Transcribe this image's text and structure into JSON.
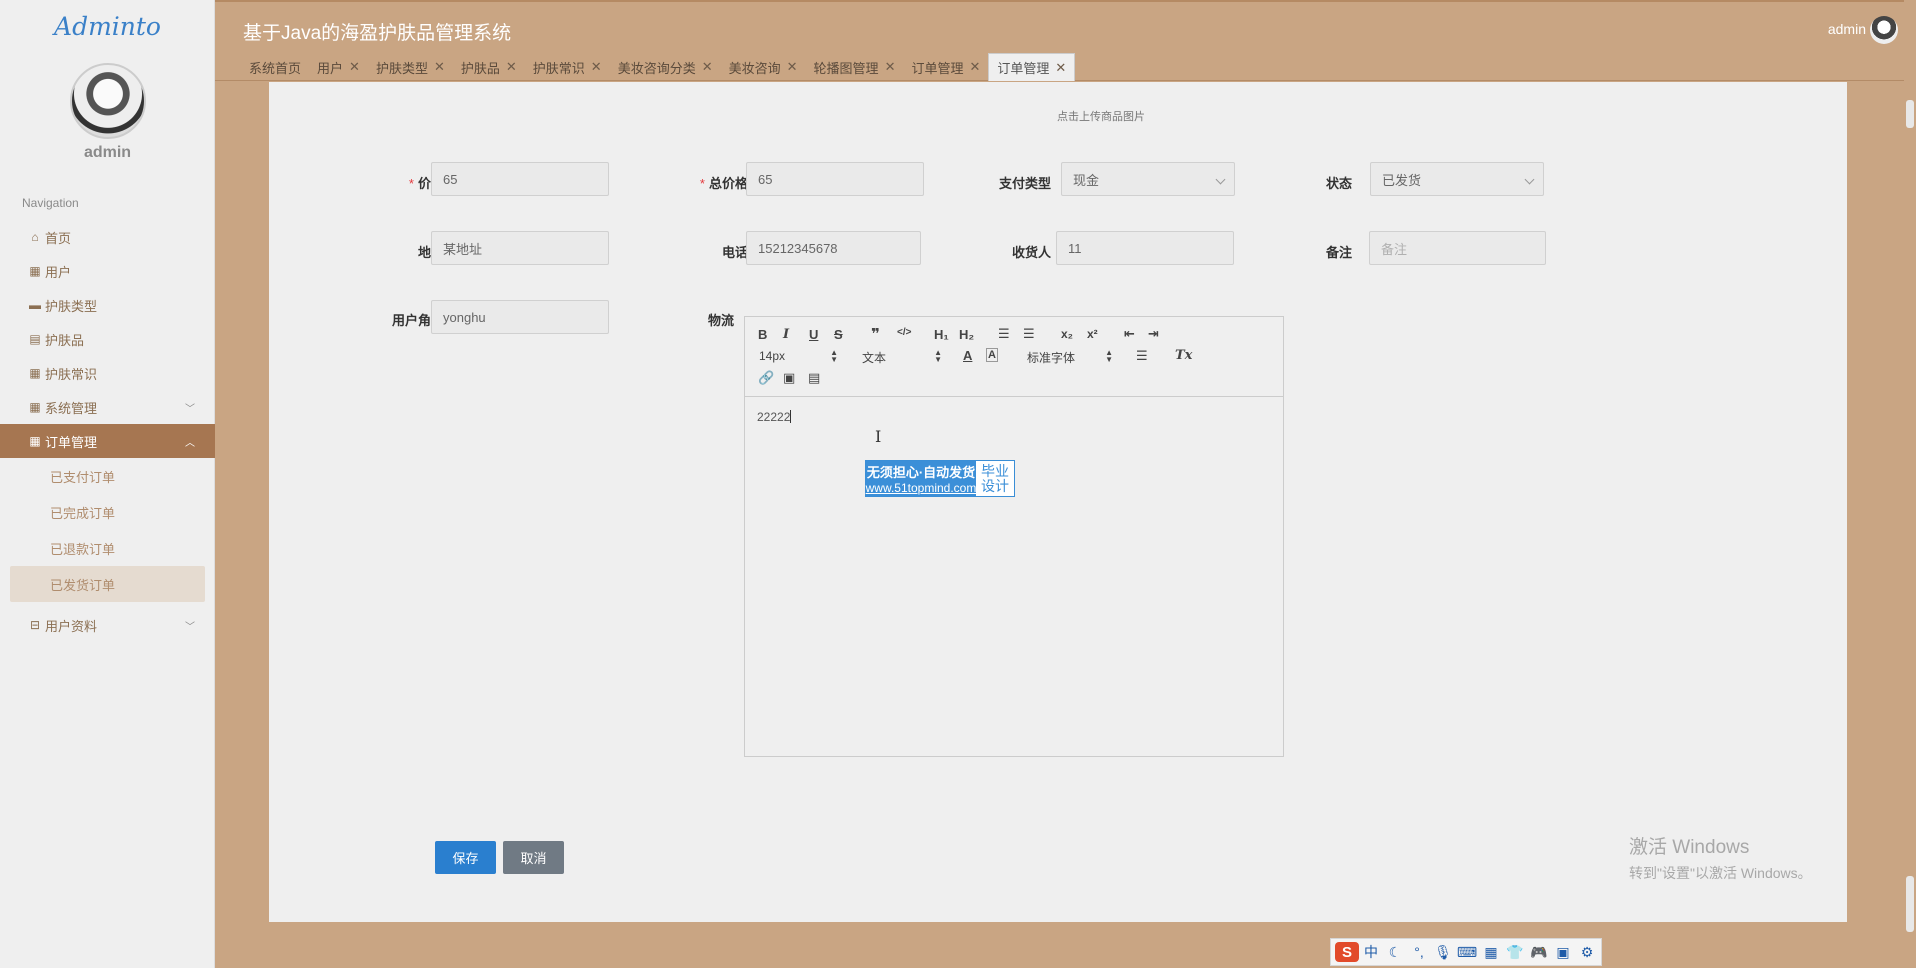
{
  "app": {
    "brand": "Adminto",
    "title": "基于Java的海盈护肤品管理系统",
    "user": "admin"
  },
  "sidebar": {
    "user_name": "admin",
    "caption": "Navigation",
    "items": [
      {
        "label": "首页",
        "icon": "home-icon"
      },
      {
        "label": "用户",
        "icon": "grid-icon"
      },
      {
        "label": "护肤类型",
        "icon": "bookmark-icon"
      },
      {
        "label": "护肤品",
        "icon": "clipboard-icon"
      },
      {
        "label": "护肤常识",
        "icon": "grid-icon"
      },
      {
        "label": "系统管理",
        "icon": "grid-icon"
      },
      {
        "label": "订单管理",
        "icon": "grid-icon"
      },
      {
        "label": "用户资料",
        "icon": "folder-icon"
      }
    ],
    "sub_items": [
      "已支付订单",
      "已完成订单",
      "已退款订单",
      "已发货订单"
    ]
  },
  "tabs": [
    "系统首页",
    "用户",
    "护肤类型",
    "护肤品",
    "护肤常识",
    "美妆咨询分类",
    "美妆咨询",
    "轮播图管理",
    "订单管理",
    "订单管理"
  ],
  "form": {
    "upload_hint": "点击上传商品图片",
    "price_label": "价格",
    "price_value": "65",
    "total_label": "总价格",
    "total_value": "65",
    "pay_type_label": "支付类型",
    "pay_type_value": "现金",
    "status_label": "状态",
    "status_value": "已发货",
    "address_label": "地址",
    "address_value": "某地址",
    "phone_label": "电话",
    "phone_value": "15212345678",
    "receiver_label": "收货人",
    "receiver_value": "11",
    "remark_label": "备注",
    "remark_placeholder": "备注",
    "role_label": "用户角色",
    "role_value": "yonghu",
    "logistics_label": "物流",
    "logistics_value": "22222",
    "save": "保存",
    "cancel": "取消"
  },
  "editor": {
    "bold": "B",
    "italic": "I",
    "underline": "U",
    "strike": "S",
    "quote": "❞",
    "code": "</>",
    "h1": "H₁",
    "h2": "H₂",
    "size": "14px",
    "font_type": "文本",
    "font_family": "标准字体",
    "color": "A",
    "bg_color": "A",
    "subscript": "x₂",
    "superscript": "x²",
    "clean": "Tx"
  },
  "badge": {
    "line1": "无须担心·自动发货",
    "line2": "www.51topmind.com",
    "right1": "毕业",
    "right2": "设计"
  },
  "watermark": {
    "line1": "激活 Windows",
    "line2": "转到\"设置\"以激活 Windows。"
  },
  "ime": [
    "S",
    "中",
    "☾",
    "°,",
    "🎙",
    "⌨",
    "▦",
    "👕",
    "🎮",
    "▣",
    "⚙"
  ]
}
